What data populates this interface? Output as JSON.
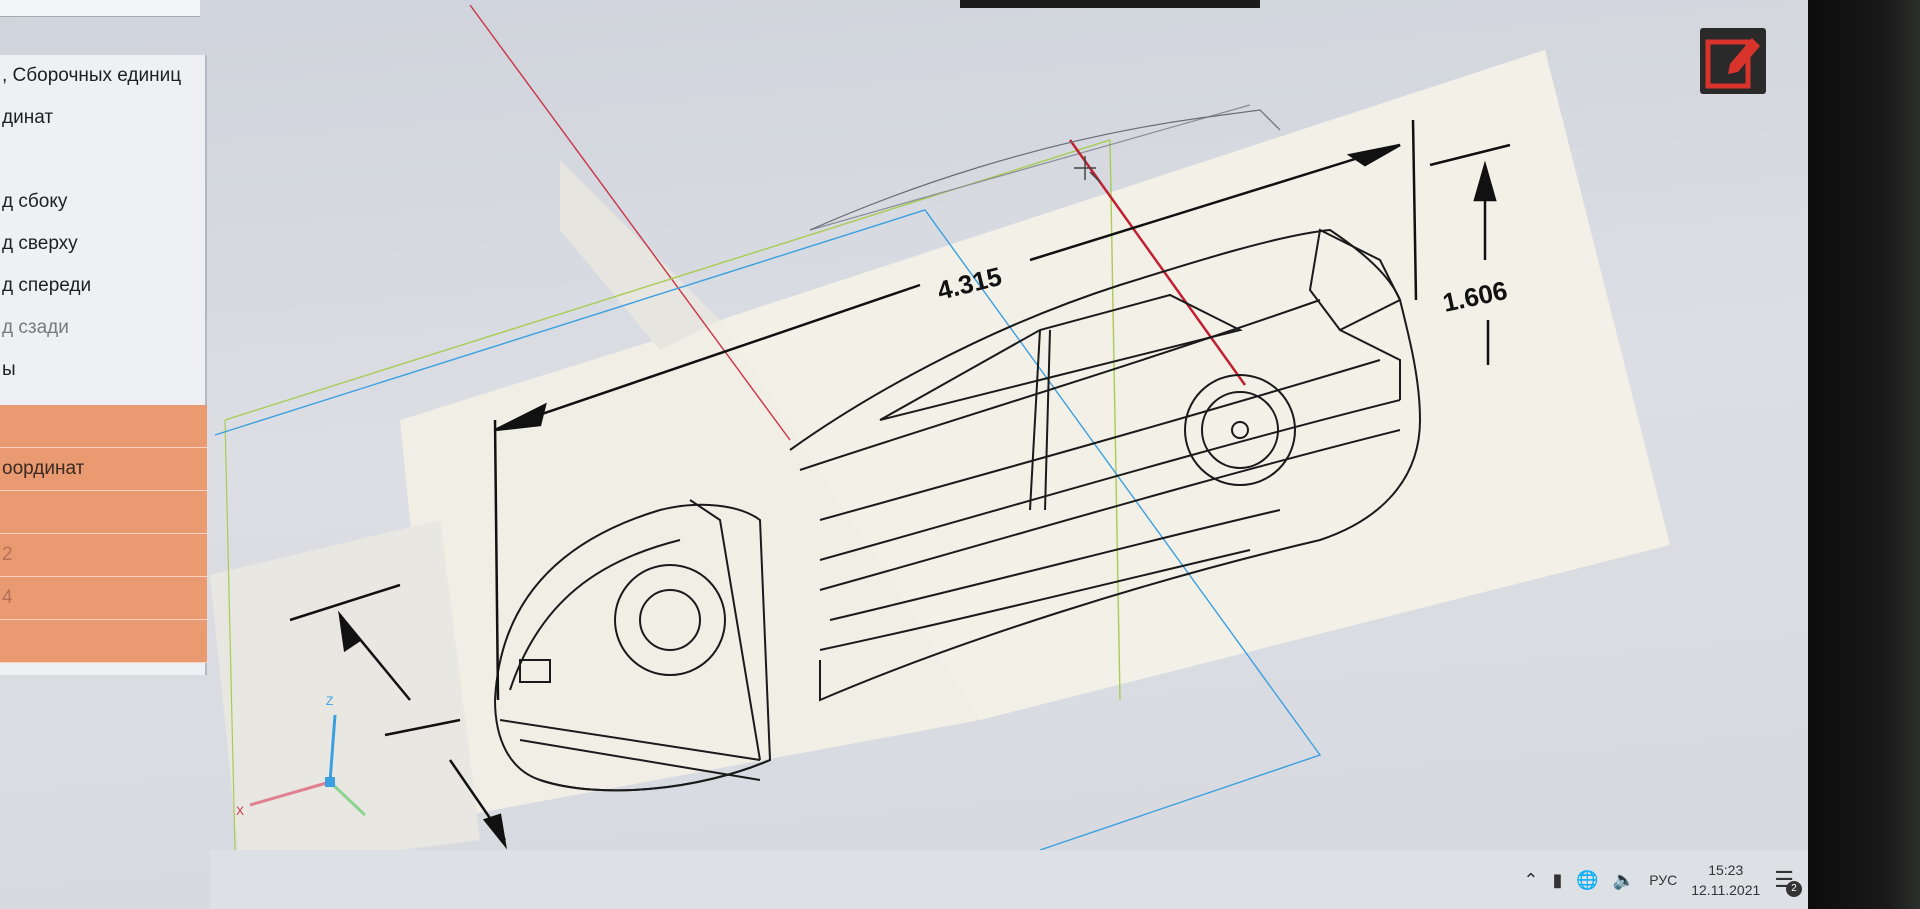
{
  "left_panel": {
    "items": [
      {
        "label": ", Сборочных единиц",
        "style": "normal"
      },
      {
        "label": "динат",
        "style": "normal"
      },
      {
        "label": "",
        "style": "normal"
      },
      {
        "label": "д сбоку",
        "style": "normal"
      },
      {
        "label": "д сверху",
        "style": "normal"
      },
      {
        "label": "д спереди",
        "style": "normal"
      },
      {
        "label": "д сзади",
        "style": "dim"
      },
      {
        "label": "ы",
        "style": "normal"
      },
      {
        "label": "",
        "style": "orange"
      },
      {
        "label": "оординат",
        "style": "orange"
      },
      {
        "label": "",
        "style": "orange"
      },
      {
        "label": "2",
        "style": "orange-dim"
      },
      {
        "label": "4",
        "style": "orange-dim"
      },
      {
        "label": "",
        "style": "orange"
      }
    ]
  },
  "drawing": {
    "dim_length": "4.315",
    "dim_height": "1.606"
  },
  "axes": {
    "x": "X",
    "z": "Z"
  },
  "taskbar": {
    "language": "РУС",
    "time": "15:23",
    "date": "12.11.2021",
    "notification_count": "2"
  },
  "icons": [
    "edit-icon",
    "chevron-up-icon",
    "battery-icon",
    "globe-icon",
    "speaker-icon",
    "notification-icon"
  ],
  "colors": {
    "panel_orange": "#e99a70",
    "edit_icon_red": "#d8342b",
    "axis_red": "#cc3344",
    "axis_blue": "#3aa0e0",
    "axis_green": "#a8cc55"
  }
}
